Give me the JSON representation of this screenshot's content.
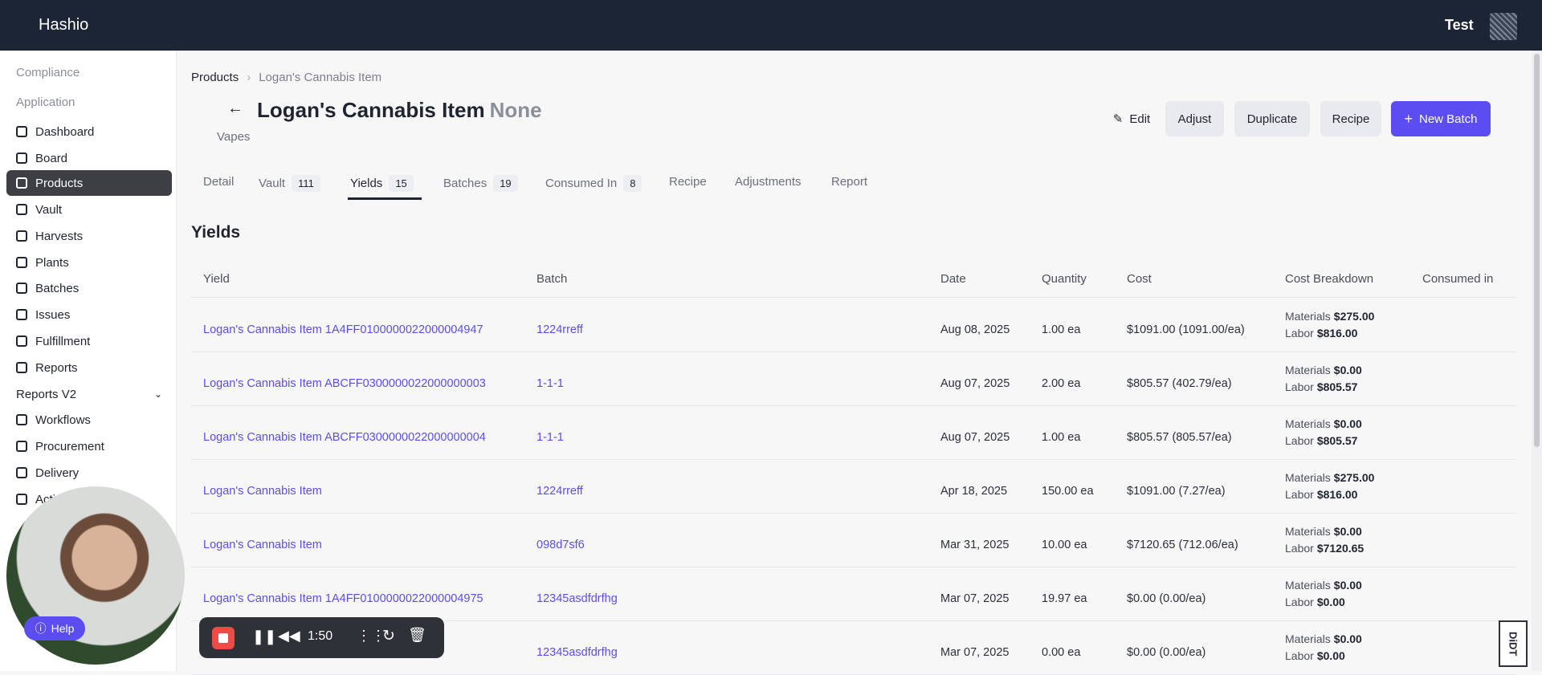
{
  "app": {
    "brand": "Hashio",
    "user": "Test"
  },
  "sidebar": {
    "sections": [
      "Compliance",
      "Application"
    ],
    "items": [
      {
        "label": "Dashboard",
        "icon": "home-icon"
      },
      {
        "label": "Board",
        "icon": "board-icon"
      },
      {
        "label": "Products",
        "icon": "flask-icon",
        "active": true
      },
      {
        "label": "Vault",
        "icon": "vault-icon"
      },
      {
        "label": "Harvests",
        "icon": "leaf-icon"
      },
      {
        "label": "Plants",
        "icon": "plant-icon"
      },
      {
        "label": "Batches",
        "icon": "layers-icon"
      },
      {
        "label": "Issues",
        "icon": "warning-icon"
      },
      {
        "label": "Fulfillment",
        "icon": "calendar-icon"
      },
      {
        "label": "Reports",
        "icon": "bar-chart-icon"
      },
      {
        "label": "Reports V2",
        "icon": "chevron-down-icon"
      },
      {
        "label": "Workflows",
        "icon": "recycle-icon"
      },
      {
        "label": "Procurement",
        "icon": "bag-icon"
      },
      {
        "label": "Delivery",
        "icon": "truck-icon"
      },
      {
        "label": "Acti",
        "icon": "clipboard-icon"
      }
    ]
  },
  "breadcrumb": {
    "root": "Products",
    "current": "Logan's Cannabis Item"
  },
  "product": {
    "title": "Logan's Cannabis Item",
    "suffix": "None",
    "category": "Vapes"
  },
  "actions": {
    "edit": "Edit",
    "adjust": "Adjust",
    "duplicate": "Duplicate",
    "recipe": "Recipe",
    "new_batch": "New Batch"
  },
  "tabs": [
    {
      "label": "Detail"
    },
    {
      "label": "Vault",
      "count": "111"
    },
    {
      "label": "Yields",
      "count": "15",
      "active": true
    },
    {
      "label": "Batches",
      "count": "19"
    },
    {
      "label": "Consumed In",
      "count": "8"
    },
    {
      "label": "Recipe"
    },
    {
      "label": "Adjustments"
    },
    {
      "label": "Report"
    }
  ],
  "section_title": "Yields",
  "table": {
    "headers": [
      "Yield",
      "Batch",
      "Date",
      "Quantity",
      "Cost",
      "Cost Breakdown",
      "Consumed in"
    ],
    "rows": [
      {
        "yield": "Logan's Cannabis Item 1A4FF0100000022000004947",
        "batch": "1224rreff",
        "date": "Aug 08, 2025",
        "qty": "1.00 ea",
        "cost": "$1091.00 (1091.00/ea)",
        "materials": "$275.00",
        "labor": "$816.00"
      },
      {
        "yield": "Logan's Cannabis Item ABCFF0300000022000000003",
        "batch": "1-1-1",
        "date": "Aug 07, 2025",
        "qty": "2.00 ea",
        "cost": "$805.57 (402.79/ea)",
        "materials": "$0.00",
        "labor": "$805.57"
      },
      {
        "yield": "Logan's Cannabis Item ABCFF0300000022000000004",
        "batch": "1-1-1",
        "date": "Aug 07, 2025",
        "qty": "1.00 ea",
        "cost": "$805.57 (805.57/ea)",
        "materials": "$0.00",
        "labor": "$805.57"
      },
      {
        "yield": "Logan's Cannabis Item",
        "batch": "1224rreff",
        "date": "Apr 18, 2025",
        "qty": "150.00 ea",
        "cost": "$1091.00 (7.27/ea)",
        "materials": "$275.00",
        "labor": "$816.00"
      },
      {
        "yield": "Logan's Cannabis Item",
        "batch": "098d7sf6",
        "date": "Mar 31, 2025",
        "qty": "10.00 ea",
        "cost": "$7120.65 (712.06/ea)",
        "materials": "$0.00",
        "labor": "$7120.65"
      },
      {
        "yield": "Logan's Cannabis Item 1A4FF0100000022000004975",
        "batch": "12345asdfdrfhg",
        "date": "Mar 07, 2025",
        "qty": "19.97 ea",
        "cost": "$0.00 (0.00/ea)",
        "materials": "$0.00",
        "labor": "$0.00"
      },
      {
        "yield": "",
        "batch": "12345asdfdrfhg",
        "date": "Mar 07, 2025",
        "qty": "0.00 ea",
        "cost": "$0.00 (0.00/ea)",
        "materials": "$0.00",
        "labor": "$0.00"
      }
    ],
    "materials_label": "Materials",
    "labor_label": "Labor"
  },
  "recorder": {
    "time": "1:50"
  },
  "help": {
    "label": "Help"
  },
  "corner_badge": "DiDT",
  "colors": {
    "accent": "#5b4df2",
    "topbar": "#1c2536",
    "active_nav": "#3d3f45"
  }
}
